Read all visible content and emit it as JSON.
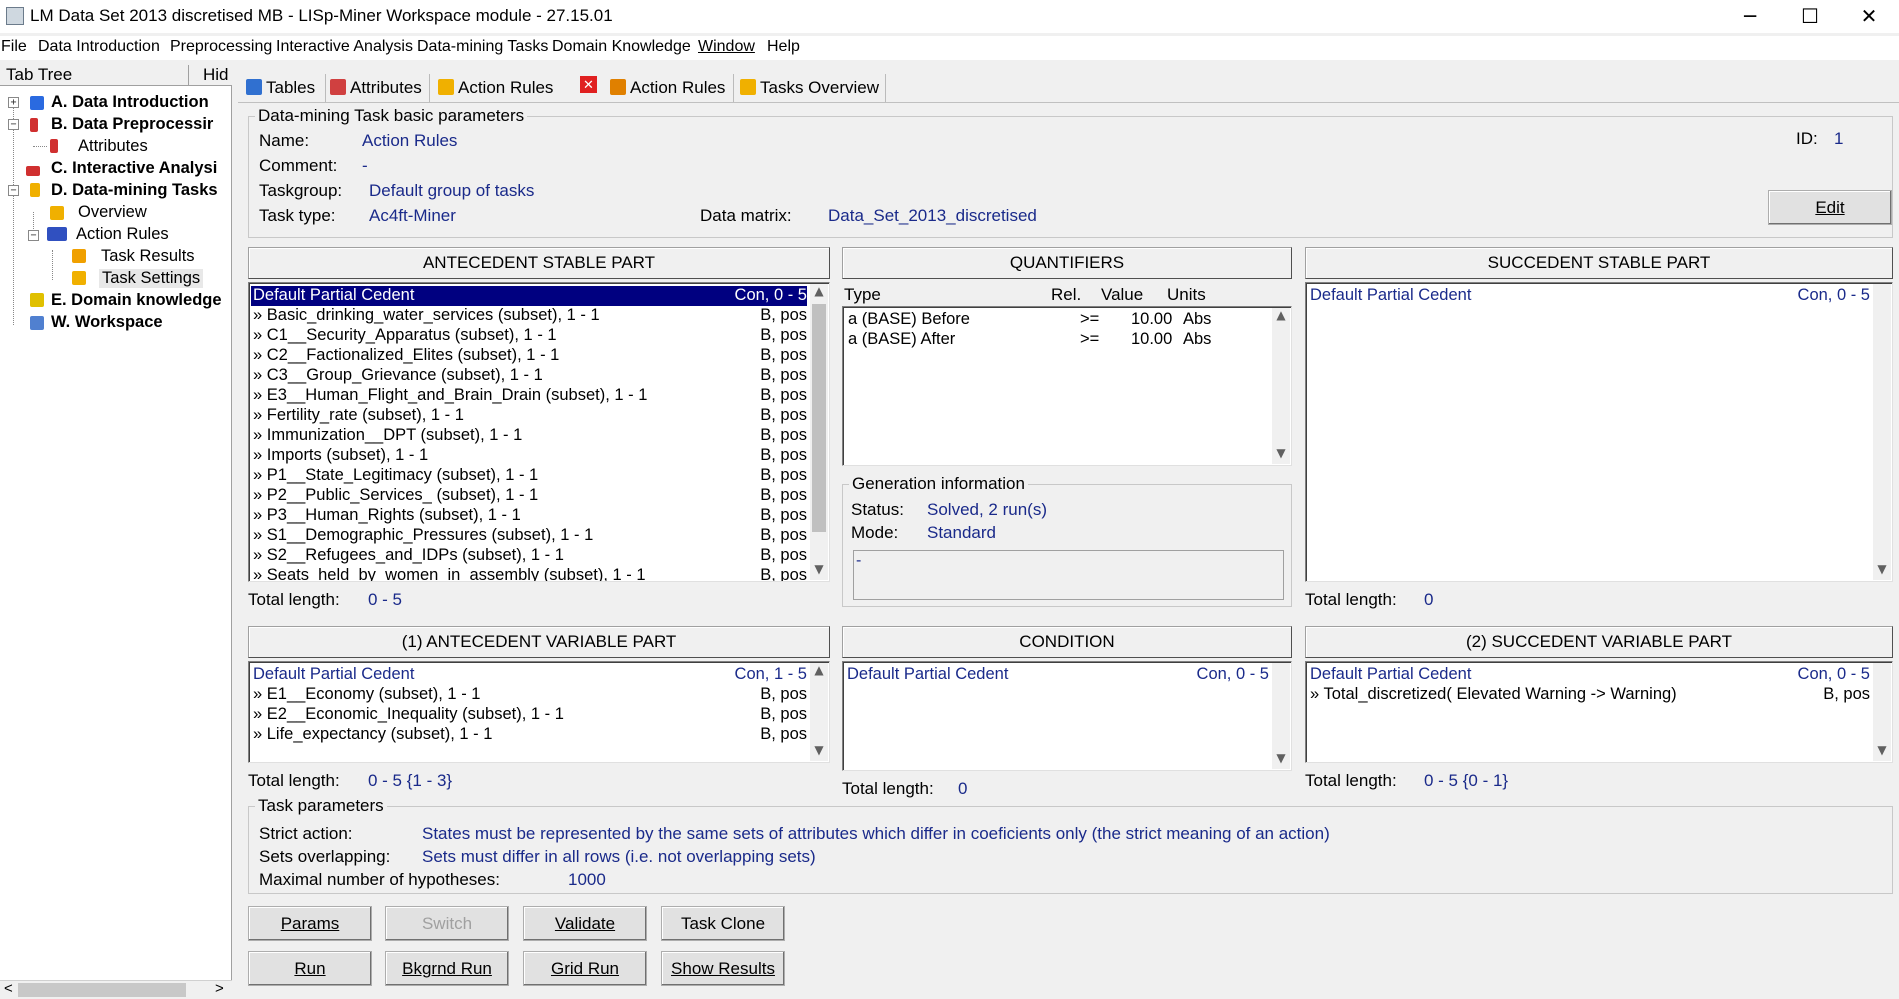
{
  "window": {
    "title": "LM Data Set 2013 discretised MB - LISp-Miner Workspace module - 27.15.01",
    "minimize": "─",
    "maximize": "☐",
    "close": "✕"
  },
  "menu": [
    "File",
    "Data Introduction",
    "Preprocessing",
    "Interactive Analysis",
    "Data-mining Tasks",
    "Domain Knowledge",
    "Window",
    "Help"
  ],
  "tree": {
    "header": "Tab Tree",
    "hide": "Hid",
    "nodes": [
      {
        "label": "A. Data Introduction",
        "bold": true,
        "color": "#1f5bd6"
      },
      {
        "label": "B. Data Preprocessir",
        "bold": true,
        "color": "#c02020"
      },
      {
        "label": "Attributes",
        "bold": false,
        "color": "#c02020"
      },
      {
        "label": "C. Interactive Analysi",
        "bold": true,
        "color": "#d03030"
      },
      {
        "label": "D. Data-mining Tasks",
        "bold": true,
        "color": "#e0a000"
      },
      {
        "label": "Overview",
        "bold": false,
        "color": "#e0a000"
      },
      {
        "label": "Action Rules",
        "bold": false,
        "color": "#3050c0"
      },
      {
        "label": "Task Results",
        "bold": false,
        "color": "#e0a000"
      },
      {
        "label": "Task Settings",
        "bold": false,
        "color": "#e0a000"
      },
      {
        "label": "E. Domain knowledge",
        "bold": true,
        "color": "#3060c0"
      },
      {
        "label": "W. Workspace",
        "bold": true,
        "color": "#3060c0"
      }
    ],
    "scroll_left": "<",
    "scroll_right": ">"
  },
  "tabs": [
    "Tables",
    "Attributes",
    "Action Rules",
    "Action Rules",
    "Tasks Overview"
  ],
  "basic": {
    "group_label": "Data-mining Task basic parameters",
    "name_label": "Name:",
    "name": "Action Rules",
    "comment_label": "Comment:",
    "comment": "-",
    "taskgroup_label": "Taskgroup:",
    "taskgroup": "Default group of tasks",
    "tasktype_label": "Task type:",
    "tasktype": "Ac4ft-Miner",
    "matrix_label": "Data matrix:",
    "matrix": "Data_Set_2013_discretised",
    "id_label": "ID:",
    "id": "1",
    "edit": "Edit"
  },
  "ant_stable": {
    "title": "ANTECEDENT STABLE PART",
    "rows": [
      {
        "text": "Default Partial Cedent",
        "right": "Con, 0 - 5"
      },
      {
        "text": "» Basic_drinking_water_services (subset), 1 - 1",
        "right": "B, pos"
      },
      {
        "text": "» C1__Security_Apparatus (subset), 1 - 1",
        "right": "B, pos"
      },
      {
        "text": "» C2__Factionalized_Elites (subset), 1 - 1",
        "right": "B, pos"
      },
      {
        "text": "» C3__Group_Grievance (subset), 1 - 1",
        "right": "B, pos"
      },
      {
        "text": "» E3__Human_Flight_and_Brain_Drain (subset), 1 - 1",
        "right": "B, pos"
      },
      {
        "text": "» Fertility_rate (subset), 1 - 1",
        "right": "B, pos"
      },
      {
        "text": "» Immunization__DPT (subset), 1 - 1",
        "right": "B, pos"
      },
      {
        "text": "» Imports (subset), 1 - 1",
        "right": "B, pos"
      },
      {
        "text": "» P1__State_Legitimacy (subset), 1 - 1",
        "right": "B, pos"
      },
      {
        "text": "» P2__Public_Services_ (subset), 1 - 1",
        "right": "B, pos"
      },
      {
        "text": "» P3__Human_Rights (subset), 1 - 1",
        "right": "B, pos"
      },
      {
        "text": "» S1__Demographic_Pressures (subset), 1 - 1",
        "right": "B, pos"
      },
      {
        "text": "» S2__Refugees_and_IDPs (subset), 1 - 1",
        "right": "B, pos"
      },
      {
        "text": "» Seats_held_by_women_in_assembly (subset), 1 - 1",
        "right": "B, pos"
      }
    ],
    "total_label": "Total length:",
    "total": "0 - 5"
  },
  "quantifiers": {
    "title": "QUANTIFIERS",
    "headers": [
      "Type",
      "Rel.",
      "Value",
      "Units"
    ],
    "rows": [
      {
        "type": "a (BASE) Before",
        "rel": ">=",
        "value": "10.00",
        "units": "Abs"
      },
      {
        "type": "a (BASE) After",
        "rel": ">=",
        "value": "10.00",
        "units": "Abs"
      }
    ]
  },
  "generation": {
    "group_label": "Generation information",
    "status_label": "Status:",
    "status": "Solved, 2 run(s)",
    "mode_label": "Mode:",
    "mode": "Standard",
    "note": "-"
  },
  "succ_stable": {
    "title": "SUCCEDENT STABLE PART",
    "rows": [
      {
        "text": "Default Partial Cedent",
        "right": "Con, 0 - 5"
      }
    ],
    "total_label": "Total length:",
    "total": "0"
  },
  "ant_var": {
    "title": "(1) ANTECEDENT VARIABLE PART",
    "rows": [
      {
        "text": "Default Partial Cedent",
        "right": "Con, 1 - 5"
      },
      {
        "text": "» E1__Economy (subset), 1 - 1",
        "right": "B, pos"
      },
      {
        "text": "» E2__Economic_Inequality (subset), 1 - 1",
        "right": "B, pos"
      },
      {
        "text": "» Life_expectancy (subset), 1 - 1",
        "right": "B, pos"
      }
    ],
    "total_label": "Total length:",
    "total": "0 - 5 {1 - 3}"
  },
  "condition": {
    "title": "CONDITION",
    "rows": [
      {
        "text": "Default Partial Cedent",
        "right": "Con, 0 - 5"
      }
    ],
    "total_label": "Total length:",
    "total": "0"
  },
  "succ_var": {
    "title": "(2) SUCCEDENT VARIABLE PART",
    "rows": [
      {
        "text": "Default Partial Cedent",
        "right": "Con, 0 - 5"
      },
      {
        "text": "» Total_discretized( Elevated Warning -> Warning)",
        "right": "B, pos"
      }
    ],
    "total_label": "Total length:",
    "total": "0 - 5 {0 - 1}"
  },
  "task_params": {
    "group_label": "Task parameters",
    "strict_label": "Strict action:",
    "strict": "States must be represented by the same sets of attributes which differ in coeficients only (the strict meaning of an action)",
    "overlap_label": "Sets overlapping:",
    "overlap": "Sets must differ in all rows (i.e. not overlapping sets)",
    "maxhyp_label": "Maximal number of hypotheses:",
    "maxhyp": "1000"
  },
  "buttons": {
    "params": "Params",
    "switch": "Switch",
    "validate": "Validate",
    "clone": "Task Clone",
    "run": "Run",
    "bkgrnd": "Bkgrnd Run",
    "grid": "Grid Run",
    "show": "Show Results"
  }
}
